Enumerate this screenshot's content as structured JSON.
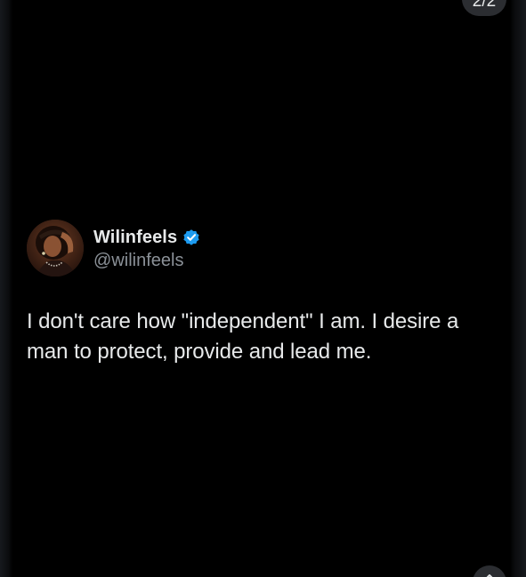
{
  "image_viewer": {
    "page_counter": "2/2",
    "bottom_button_icon": "chevron-up-icon"
  },
  "tweet": {
    "display_name": "Wilinfeels",
    "verified": true,
    "verified_badge_icon": "verified-badge-icon",
    "handle": "@wilinfeels",
    "text": "I don't care how \"independent\" I am. I desire a man to protect, provide and lead me."
  },
  "colors": {
    "background": "#000000",
    "text_primary": "#e7e9ea",
    "text_secondary": "#8b9198",
    "verified_blue": "#1d9bf0",
    "overlay_button": "#2b2d31"
  }
}
